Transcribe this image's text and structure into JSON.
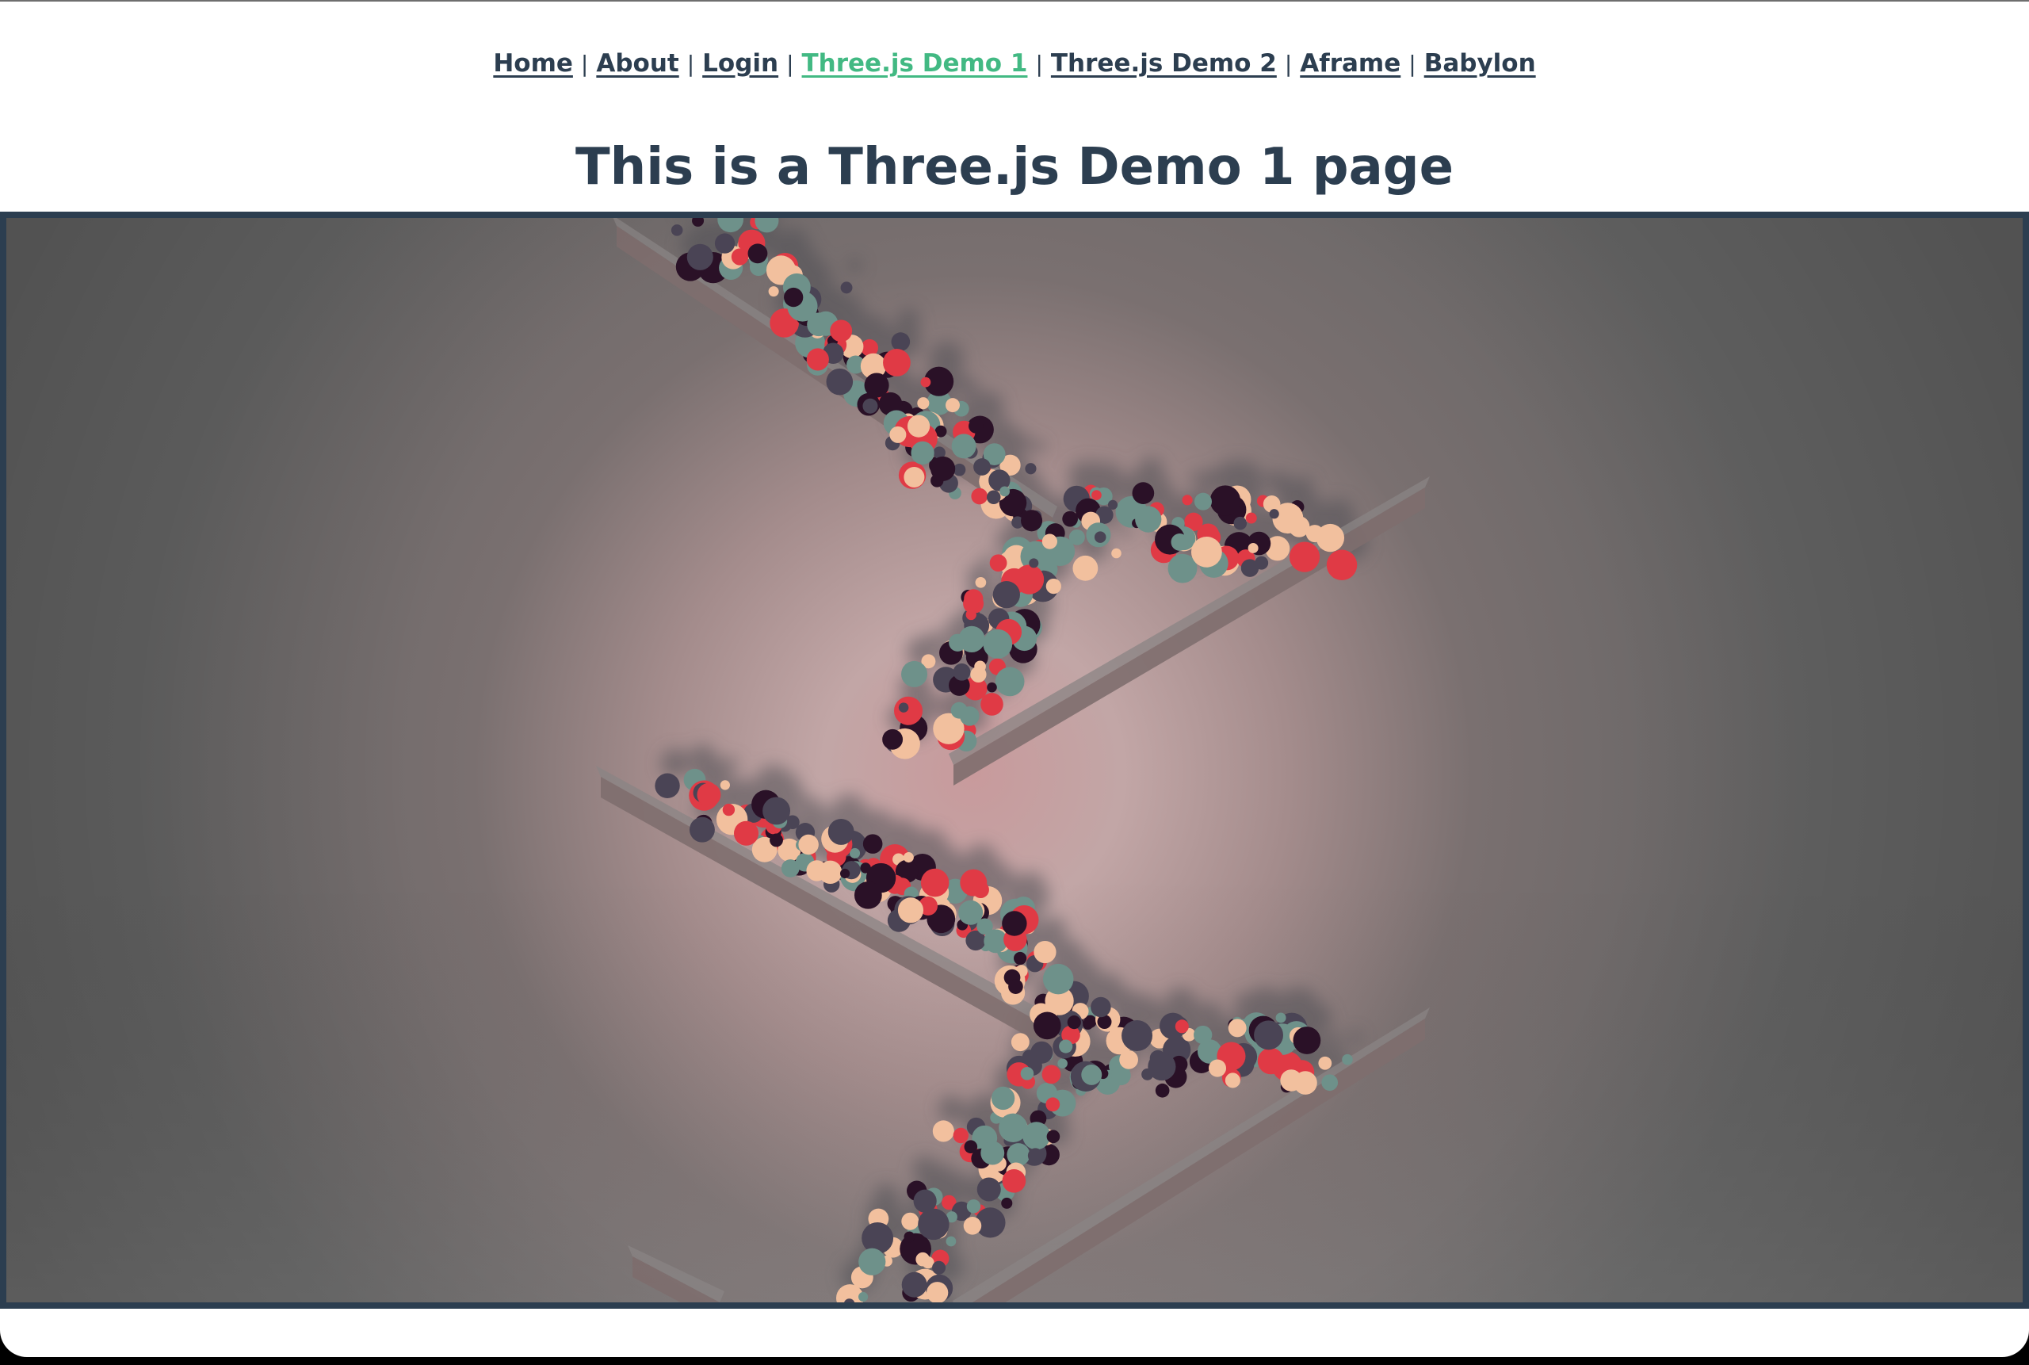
{
  "nav": {
    "links": [
      {
        "label": "Home",
        "active": false
      },
      {
        "label": "About",
        "active": false
      },
      {
        "label": "Login",
        "active": false
      },
      {
        "label": "Three.js Demo 1",
        "active": true
      },
      {
        "label": "Three.js Demo 2",
        "active": false
      },
      {
        "label": "Aframe",
        "active": false
      },
      {
        "label": "Babylon",
        "active": false
      }
    ],
    "separator": "|"
  },
  "page_title": "This is a Three.js Demo 1 page",
  "colors": {
    "text": "#2c3e50",
    "active_link": "#42b983",
    "canvas_border": "#2c3e50",
    "ball_palette": [
      "#2a1127",
      "#4a4455",
      "#6e918a",
      "#e03a45",
      "#f2c09e"
    ]
  }
}
